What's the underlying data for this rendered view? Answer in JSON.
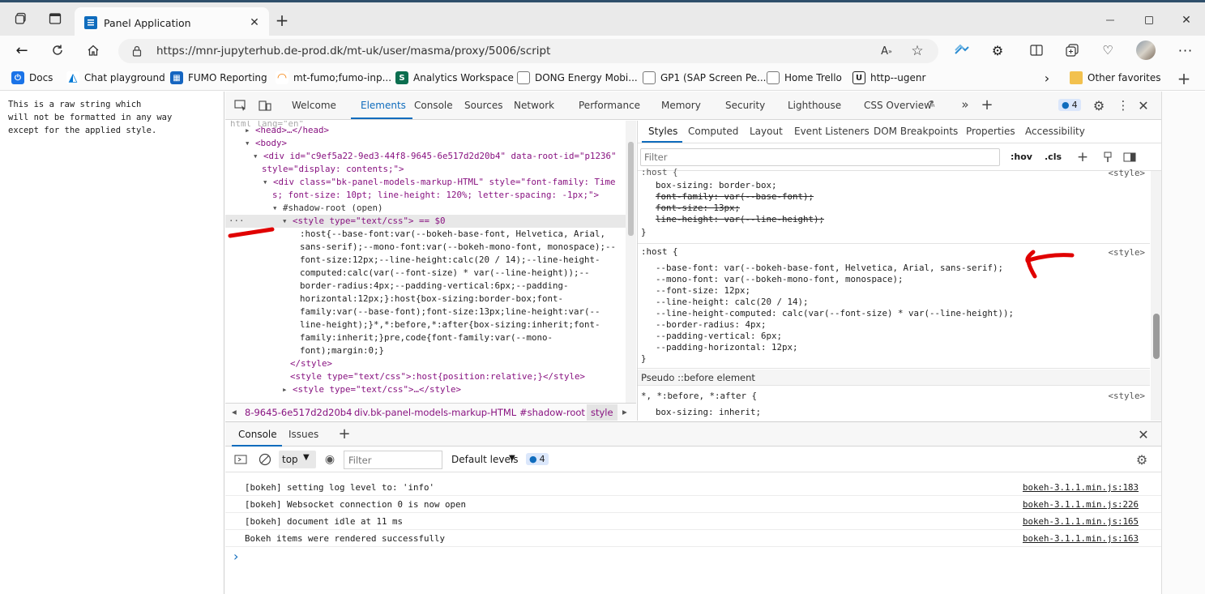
{
  "browser": {
    "tab_title": "Panel Application",
    "url": "https://mnr-jupyterhub.de-prod.dk/mt-uk/user/masma/proxy/5006/script",
    "favorites": [
      {
        "label": "Docs",
        "icon": "docs-icon",
        "color": "#1a73e8"
      },
      {
        "label": "Chat playground",
        "icon": "azure-icon",
        "color": "#0078d4"
      },
      {
        "label": "FUMO Reporting",
        "icon": "grid-icon",
        "color": "#1565c0"
      },
      {
        "label": "mt-fumo;fumo-inp...",
        "icon": "swirl-icon",
        "color": "#f57c00"
      },
      {
        "label": "Analytics Workspace",
        "icon": "analytics-icon",
        "color": "#0b6e4f"
      },
      {
        "label": "DONG Energy Mobi...",
        "icon": "page-icon",
        "color": "#777777"
      },
      {
        "label": "GP1 (SAP Screen Pe...",
        "icon": "page-icon",
        "color": "#777777"
      },
      {
        "label": "Home  Trello",
        "icon": "page-icon",
        "color": "#777777"
      },
      {
        "label": "http--ugenr",
        "icon": "u-icon",
        "color": "#222222"
      }
    ],
    "other_favorites": "Other favorites"
  },
  "page": {
    "text": "This is a raw string which\nwill not be formatted in any way\nexcept for the applied style."
  },
  "devtools": {
    "tabs": [
      "Welcome",
      "Elements",
      "Console",
      "Sources",
      "Network",
      "Performance",
      "Memory",
      "Security",
      "Lighthouse",
      "CSS Overview"
    ],
    "active_tab": "Elements",
    "issues_count": "4",
    "dom_lines": [
      "<head>…</head>",
      "<body>",
      "<div id=\"c9ef5a22-9ed3-44f8-9645-6e517d2d20b4\" data-root-id=\"p1236\"",
      "style=\"display: contents;\">",
      "<div class=\"bk-panel-models-markup-HTML\" style=\"font-family: Time",
      "s; font-size: 10pt; line-height: 120%; letter-spacing: -1px;\">",
      "#shadow-root (open)",
      "<style type=\"text/css\"> == $0",
      ":host{--base-font:var(--bokeh-base-font, Helvetica, Arial,",
      "sans-serif);--mono-font:var(--bokeh-mono-font, monospace);--",
      "font-size:12px;--line-height:calc(20 / 14);--line-height-",
      "computed:calc(var(--font-size) * var(--line-height));--",
      "border-radius:4px;--padding-vertical:6px;--padding-",
      "horizontal:12px;}:host{box-sizing:border-box;font-",
      "family:var(--base-font);font-size:13px;line-height:var(--",
      "line-height);}*,*:before,*:after{box-sizing:inherit;font-",
      "family:inherit;}pre,code{font-family:var(--mono-",
      "font);margin:0;}",
      "</style>",
      "<style type=\"text/css\">:host{position:relative;}</style>",
      "<style type=\"text/css\">…</style>"
    ],
    "breadcrumbs": [
      "8-9645-6e517d2d20b4",
      "div.bk-panel-models-markup-HTML",
      "#shadow-root",
      "style"
    ],
    "styles_tabs": [
      "Styles",
      "Computed",
      "Layout",
      "Event Listeners",
      "DOM Breakpoints",
      "Properties",
      "Accessibility"
    ],
    "filter_placeholder": "Filter",
    "hov": ":hov",
    "cls": ".cls",
    "rule1": {
      "selector": ":host {",
      "source": "<style>",
      "decls": [
        "box-sizing: border-box;",
        "font-family: var(--base-font);",
        "font-size: 13px;",
        "line-height: var(--line-height);"
      ],
      "close": "}"
    },
    "rule2": {
      "selector": ":host {",
      "source": "<style>",
      "decls": [
        "--base-font: var(--bokeh-base-font, Helvetica, Arial, sans-serif);",
        "--mono-font: var(--bokeh-mono-font, monospace);",
        "--font-size: 12px;",
        "--line-height: calc(20 / 14);",
        "--line-height-computed: calc(var(--font-size) * var(--line-height));",
        "--border-radius: 4px;",
        "--padding-vertical: 6px;",
        "--padding-horizontal: 12px;"
      ],
      "close": "}"
    },
    "pseudo_header": "Pseudo ::before element",
    "rule3": {
      "selector": "*, *:before, *:after {",
      "source": "<style>",
      "decls": [
        "box-sizing: inherit;"
      ]
    },
    "drawer_tabs": [
      "Console",
      "Issues"
    ],
    "console_context": "top",
    "console_filter_placeholder": "Filter",
    "default_levels": "Default levels",
    "console_badge": "4",
    "messages": [
      {
        "text": "[bokeh] setting log level to: 'info'",
        "link": "bokeh-3.1.1.min.js:183"
      },
      {
        "text": "[bokeh] Websocket connection 0 is now open",
        "link": "bokeh-3.1.1.min.js:226"
      },
      {
        "text": "[bokeh] document idle at 11 ms",
        "link": "bokeh-3.1.1.min.js:165"
      },
      {
        "text": "Bokeh items were rendered successfully",
        "link": "bokeh-3.1.1.min.js:163"
      }
    ],
    "prompt": "›"
  },
  "colors": {
    "annotation": "#e00000",
    "accent": "#0f6cbd"
  }
}
